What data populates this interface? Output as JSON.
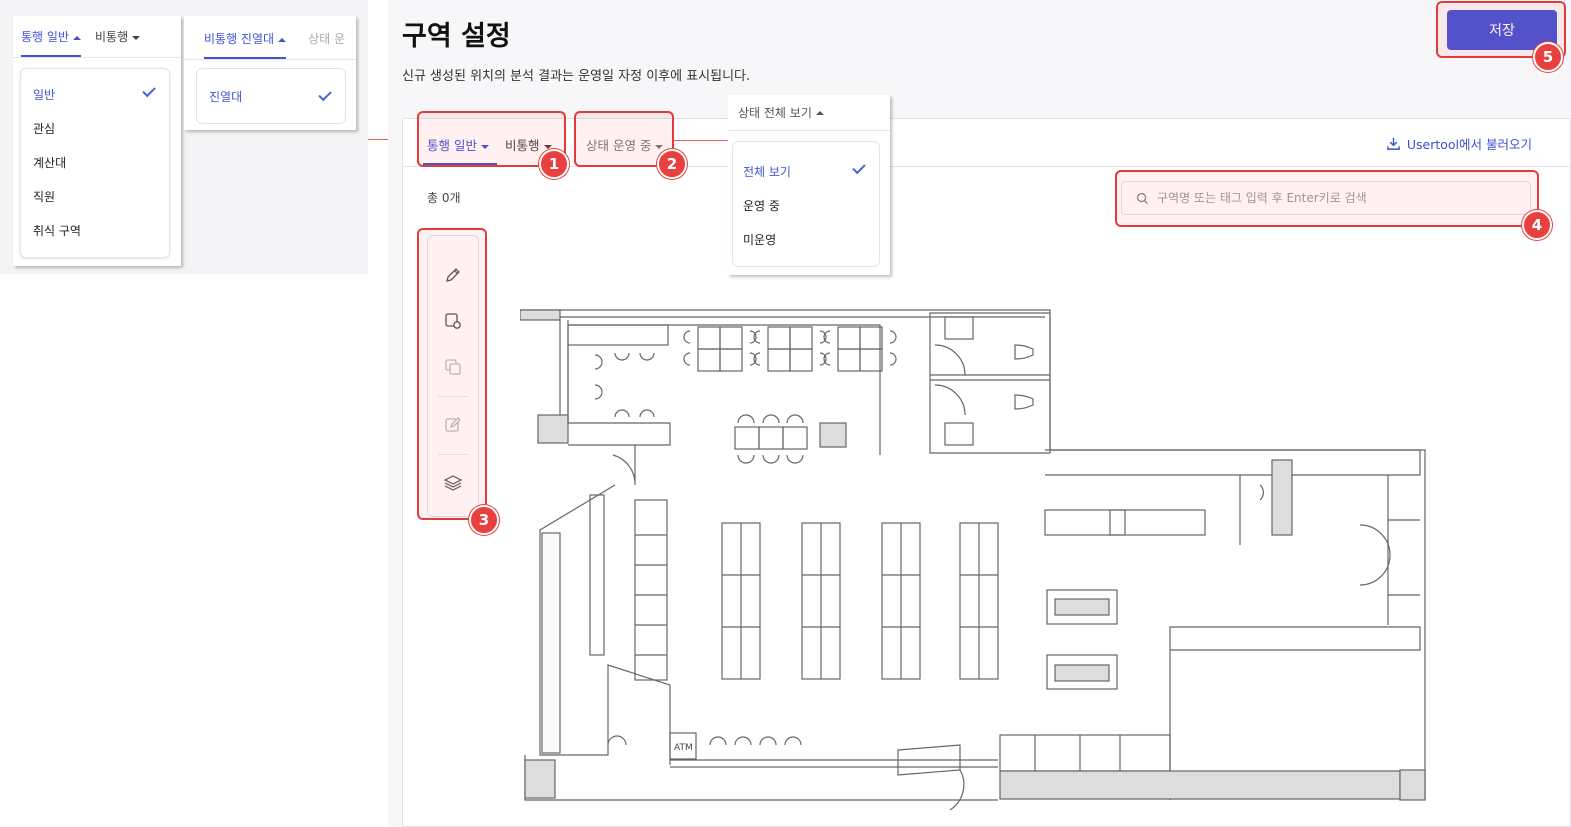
{
  "inset_panel": {
    "tabs": [
      {
        "label": "통행 일반",
        "active": true
      },
      {
        "label": "비통행",
        "active": false
      }
    ],
    "list": [
      {
        "label": "일반",
        "selected": true
      },
      {
        "label": "관심",
        "selected": false
      },
      {
        "label": "계산대",
        "selected": false
      },
      {
        "label": "직원",
        "selected": false
      },
      {
        "label": "취식 구역",
        "selected": false
      }
    ],
    "tabs2": [
      {
        "label": "비통행 진열대",
        "active": true
      },
      {
        "label": "상태 운",
        "active": false
      }
    ],
    "list2": [
      {
        "label": "진열대",
        "selected": true
      }
    ]
  },
  "header": {
    "title": "구역 설정",
    "subtitle": "신규 생성된 위치의 분석 결과는 운영일 자정 이후에 표시됩니다.",
    "save_label": "저장"
  },
  "card": {
    "tabs": [
      {
        "label": "통행 일반",
        "active": true
      },
      {
        "label": "비통행",
        "active": false
      },
      {
        "label": "상태 운영 중",
        "active": false
      }
    ],
    "import_label": "Usertool에서 불러오기",
    "total_label": "총 0개",
    "search_placeholder": "구역명 또는 태그 입력 후 Enter키로 검색"
  },
  "toolbar": {
    "tools": [
      "pencil-icon",
      "rect-add-icon",
      "copy-icon",
      "edit-icon",
      "layers-icon"
    ]
  },
  "status_dropdown": {
    "header": "상태 전체 보기",
    "options": [
      {
        "label": "전체 보기",
        "selected": true
      },
      {
        "label": "운영 중",
        "selected": false
      },
      {
        "label": "미운영",
        "selected": false
      }
    ]
  },
  "floorplan": {
    "atm_label": "ATM"
  },
  "annotations": [
    "1",
    "2",
    "3",
    "4",
    "5"
  ],
  "colors": {
    "accent": "#4553d6",
    "highlight": "#e33a3a"
  }
}
